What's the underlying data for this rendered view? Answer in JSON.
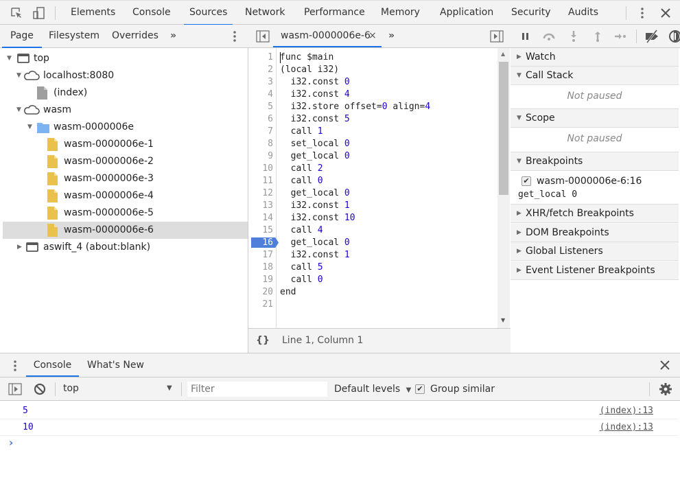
{
  "main_tabs": [
    {
      "label": "Elements"
    },
    {
      "label": "Console"
    },
    {
      "label": "Sources",
      "active": true
    },
    {
      "label": "Network"
    },
    {
      "label": "Performance"
    },
    {
      "label": "Memory"
    },
    {
      "label": "Application"
    },
    {
      "label": "Security"
    },
    {
      "label": "Audits"
    }
  ],
  "navigator": {
    "tabs": [
      {
        "label": "Page",
        "active": true
      },
      {
        "label": "Filesystem"
      },
      {
        "label": "Overrides"
      }
    ],
    "more": "»",
    "tree": [
      {
        "label": "top",
        "icon": "frame-icon",
        "expanded": true
      },
      {
        "label": "localhost:8080",
        "icon": "cloud-icon",
        "expanded": true
      },
      {
        "label": "(index)",
        "icon": "file-icon-gray"
      },
      {
        "label": "wasm",
        "icon": "cloud-icon",
        "expanded": true
      },
      {
        "label": "wasm-0000006e",
        "icon": "folder-icon",
        "expanded": true
      },
      {
        "label": "wasm-0000006e-1",
        "icon": "file-icon-yellow"
      },
      {
        "label": "wasm-0000006e-2",
        "icon": "file-icon-yellow"
      },
      {
        "label": "wasm-0000006e-3",
        "icon": "file-icon-yellow"
      },
      {
        "label": "wasm-0000006e-4",
        "icon": "file-icon-yellow"
      },
      {
        "label": "wasm-0000006e-5",
        "icon": "file-icon-yellow"
      },
      {
        "label": "wasm-0000006e-6",
        "icon": "file-icon-yellow",
        "selected": true
      },
      {
        "label": "aswift_4 (about:blank)",
        "icon": "frame-icon",
        "expanded": false
      }
    ]
  },
  "editor": {
    "tab_label": "wasm-0000006e-6",
    "close": "×",
    "more": "»",
    "breakpoint_line": 16,
    "lines": [
      {
        "n": "1",
        "code": "func $main",
        "arg": ""
      },
      {
        "n": "2",
        "code": "(local i32)",
        "arg": ""
      },
      {
        "n": "3",
        "code": "  i32.const ",
        "arg": "0"
      },
      {
        "n": "4",
        "code": "  i32.const ",
        "arg": "4"
      },
      {
        "n": "5",
        "code": "  i32.store offset=",
        "arg": "0",
        "code2": " align=",
        "arg2": "4"
      },
      {
        "n": "6",
        "code": "  i32.const ",
        "arg": "5"
      },
      {
        "n": "7",
        "code": "  call ",
        "arg": "1"
      },
      {
        "n": "8",
        "code": "  set_local ",
        "arg": "0"
      },
      {
        "n": "9",
        "code": "  get_local ",
        "arg": "0"
      },
      {
        "n": "10",
        "code": "  call ",
        "arg": "2"
      },
      {
        "n": "11",
        "code": "  call ",
        "arg": "0"
      },
      {
        "n": "12",
        "code": "  get_local ",
        "arg": "0"
      },
      {
        "n": "13",
        "code": "  i32.const ",
        "arg": "1"
      },
      {
        "n": "14",
        "code": "  i32.const ",
        "arg": "10"
      },
      {
        "n": "15",
        "code": "  call ",
        "arg": "4"
      },
      {
        "n": "16",
        "code": "  get_local ",
        "arg": "0"
      },
      {
        "n": "17",
        "code": "  i32.const ",
        "arg": "1"
      },
      {
        "n": "18",
        "code": "  call ",
        "arg": "5"
      },
      {
        "n": "19",
        "code": "  call ",
        "arg": "0"
      },
      {
        "n": "20",
        "code": "end",
        "arg": ""
      },
      {
        "n": "21",
        "code": "",
        "arg": ""
      }
    ],
    "footer": {
      "format_label": "{}",
      "position": "Line 1, Column 1"
    }
  },
  "debugger": {
    "panes": {
      "watch": "Watch",
      "call_stack": "Call Stack",
      "call_stack_empty": "Not paused",
      "scope": "Scope",
      "scope_empty": "Not paused",
      "breakpoints": "Breakpoints",
      "xhr": "XHR/fetch Breakpoints",
      "dom": "DOM Breakpoints",
      "global": "Global Listeners",
      "event": "Event Listener Breakpoints"
    },
    "breakpoint": {
      "location": "wasm-0000006e-6:16",
      "code": "get_local 0",
      "checked": true
    }
  },
  "drawer": {
    "tabs": [
      {
        "label": "Console",
        "active": true
      },
      {
        "label": "What's New"
      }
    ],
    "context": "top",
    "filter_placeholder": "Filter",
    "levels": "Default levels",
    "group_similar": "Group similar",
    "group_similar_checked": true,
    "messages": [
      {
        "value": "5",
        "source": "(index):13"
      },
      {
        "value": "10",
        "source": "(index):13"
      }
    ],
    "prompt": "›"
  },
  "colors": {
    "accent": "#1a73e8",
    "breakpoint": "#4e7fdb",
    "number": "#1c00cf"
  }
}
